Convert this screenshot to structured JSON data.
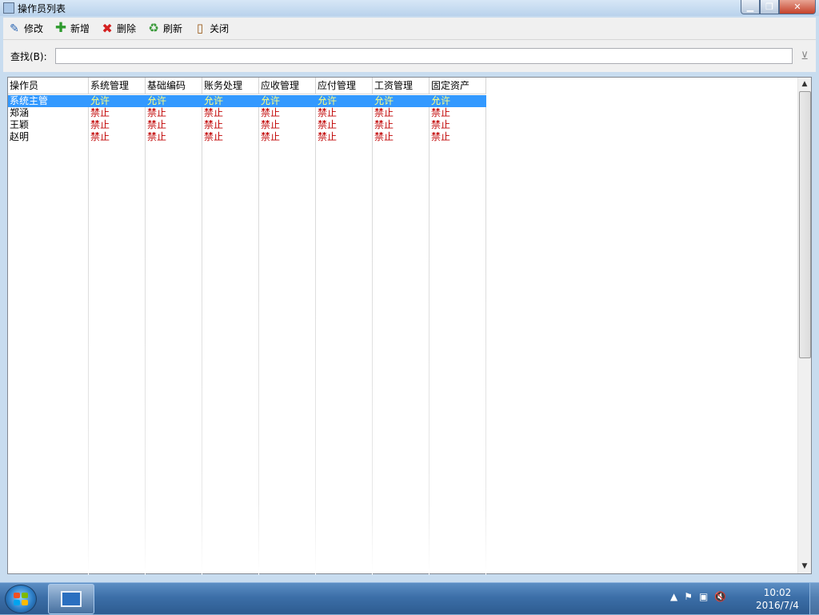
{
  "window": {
    "title": "操作员列表"
  },
  "toolbar": {
    "edit": "修改",
    "add": "新增",
    "delete": "删除",
    "refresh": "刷新",
    "close": "关闭"
  },
  "search": {
    "label": "查找(B):",
    "value": ""
  },
  "grid": {
    "headers": [
      "操作员",
      "系统管理",
      "基础编码",
      "账务处理",
      "应收管理",
      "应付管理",
      "工资管理",
      "固定资产"
    ],
    "rows": [
      {
        "name": "系统主管",
        "perms": [
          "允许",
          "允许",
          "允许",
          "允许",
          "允许",
          "允许",
          "允许"
        ],
        "selected": true
      },
      {
        "name": "郑涵",
        "perms": [
          "禁止",
          "禁止",
          "禁止",
          "禁止",
          "禁止",
          "禁止",
          "禁止"
        ],
        "selected": false
      },
      {
        "name": "王颖",
        "perms": [
          "禁止",
          "禁止",
          "禁止",
          "禁止",
          "禁止",
          "禁止",
          "禁止"
        ],
        "selected": false
      },
      {
        "name": "赵明",
        "perms": [
          "禁止",
          "禁止",
          "禁止",
          "禁止",
          "禁止",
          "禁止",
          "禁止"
        ],
        "selected": false
      }
    ]
  },
  "colors": {
    "selection": "#3399ff",
    "allow": "#ffff80",
    "deny": "#c00000"
  },
  "icons": {
    "edit": "edit-icon",
    "add": "add-icon",
    "delete": "delete-icon",
    "refresh": "refresh-icon",
    "close": "close-door-icon"
  },
  "taskbar": {
    "time": "10:02",
    "date": "2016/7/4"
  }
}
